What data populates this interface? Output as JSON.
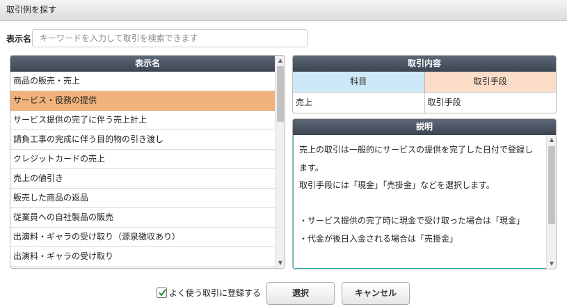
{
  "window": {
    "title": "取引例を探す"
  },
  "search": {
    "label": "表示名",
    "placeholder": "キーワードを入力して取引を検索できます",
    "value": ""
  },
  "list": {
    "header": "表示名",
    "items": [
      "商品の販売・売上",
      "サービス・役務の提供",
      "サービス提供の完了に伴う売上計上",
      "請負工事の完成に伴う目的物の引き渡し",
      "クレジットカードの売上",
      "売上の値引き",
      "販売した商品の返品",
      "従業員への自社製品の販売",
      "出演料・ギャラの受け取り（源泉徴収あり）",
      "出演料・ギャラの受け取り"
    ],
    "selected_index": 1
  },
  "detail": {
    "header": "取引内容",
    "col_kamoku": "科目",
    "col_shudan": "取引手段",
    "kamoku_value": "売上",
    "shudan_value": "取引手段"
  },
  "explanation": {
    "header": "説明",
    "lines": [
      "売上の取引は一般的にサービスの提供を完了した日付で登録し",
      "ます。",
      "取引手段には「現金」「売掛金」などを選択します。",
      "",
      "・サービス提供の完了時に現金で受け取った場合は「現金」",
      "・代金が後日入金される場合は「売掛金」"
    ]
  },
  "footer": {
    "register_label": "よく使う取引に登録する",
    "register_checked": true,
    "select_label": "選択",
    "cancel_label": "キャンセル"
  },
  "colors": {
    "header_dark": "#3d4553",
    "selected_row": "#f0b27a",
    "kamoku_head": "#cde9f7",
    "shudan_head": "#fbdcc8",
    "focus_border": "#2fb0b8"
  }
}
